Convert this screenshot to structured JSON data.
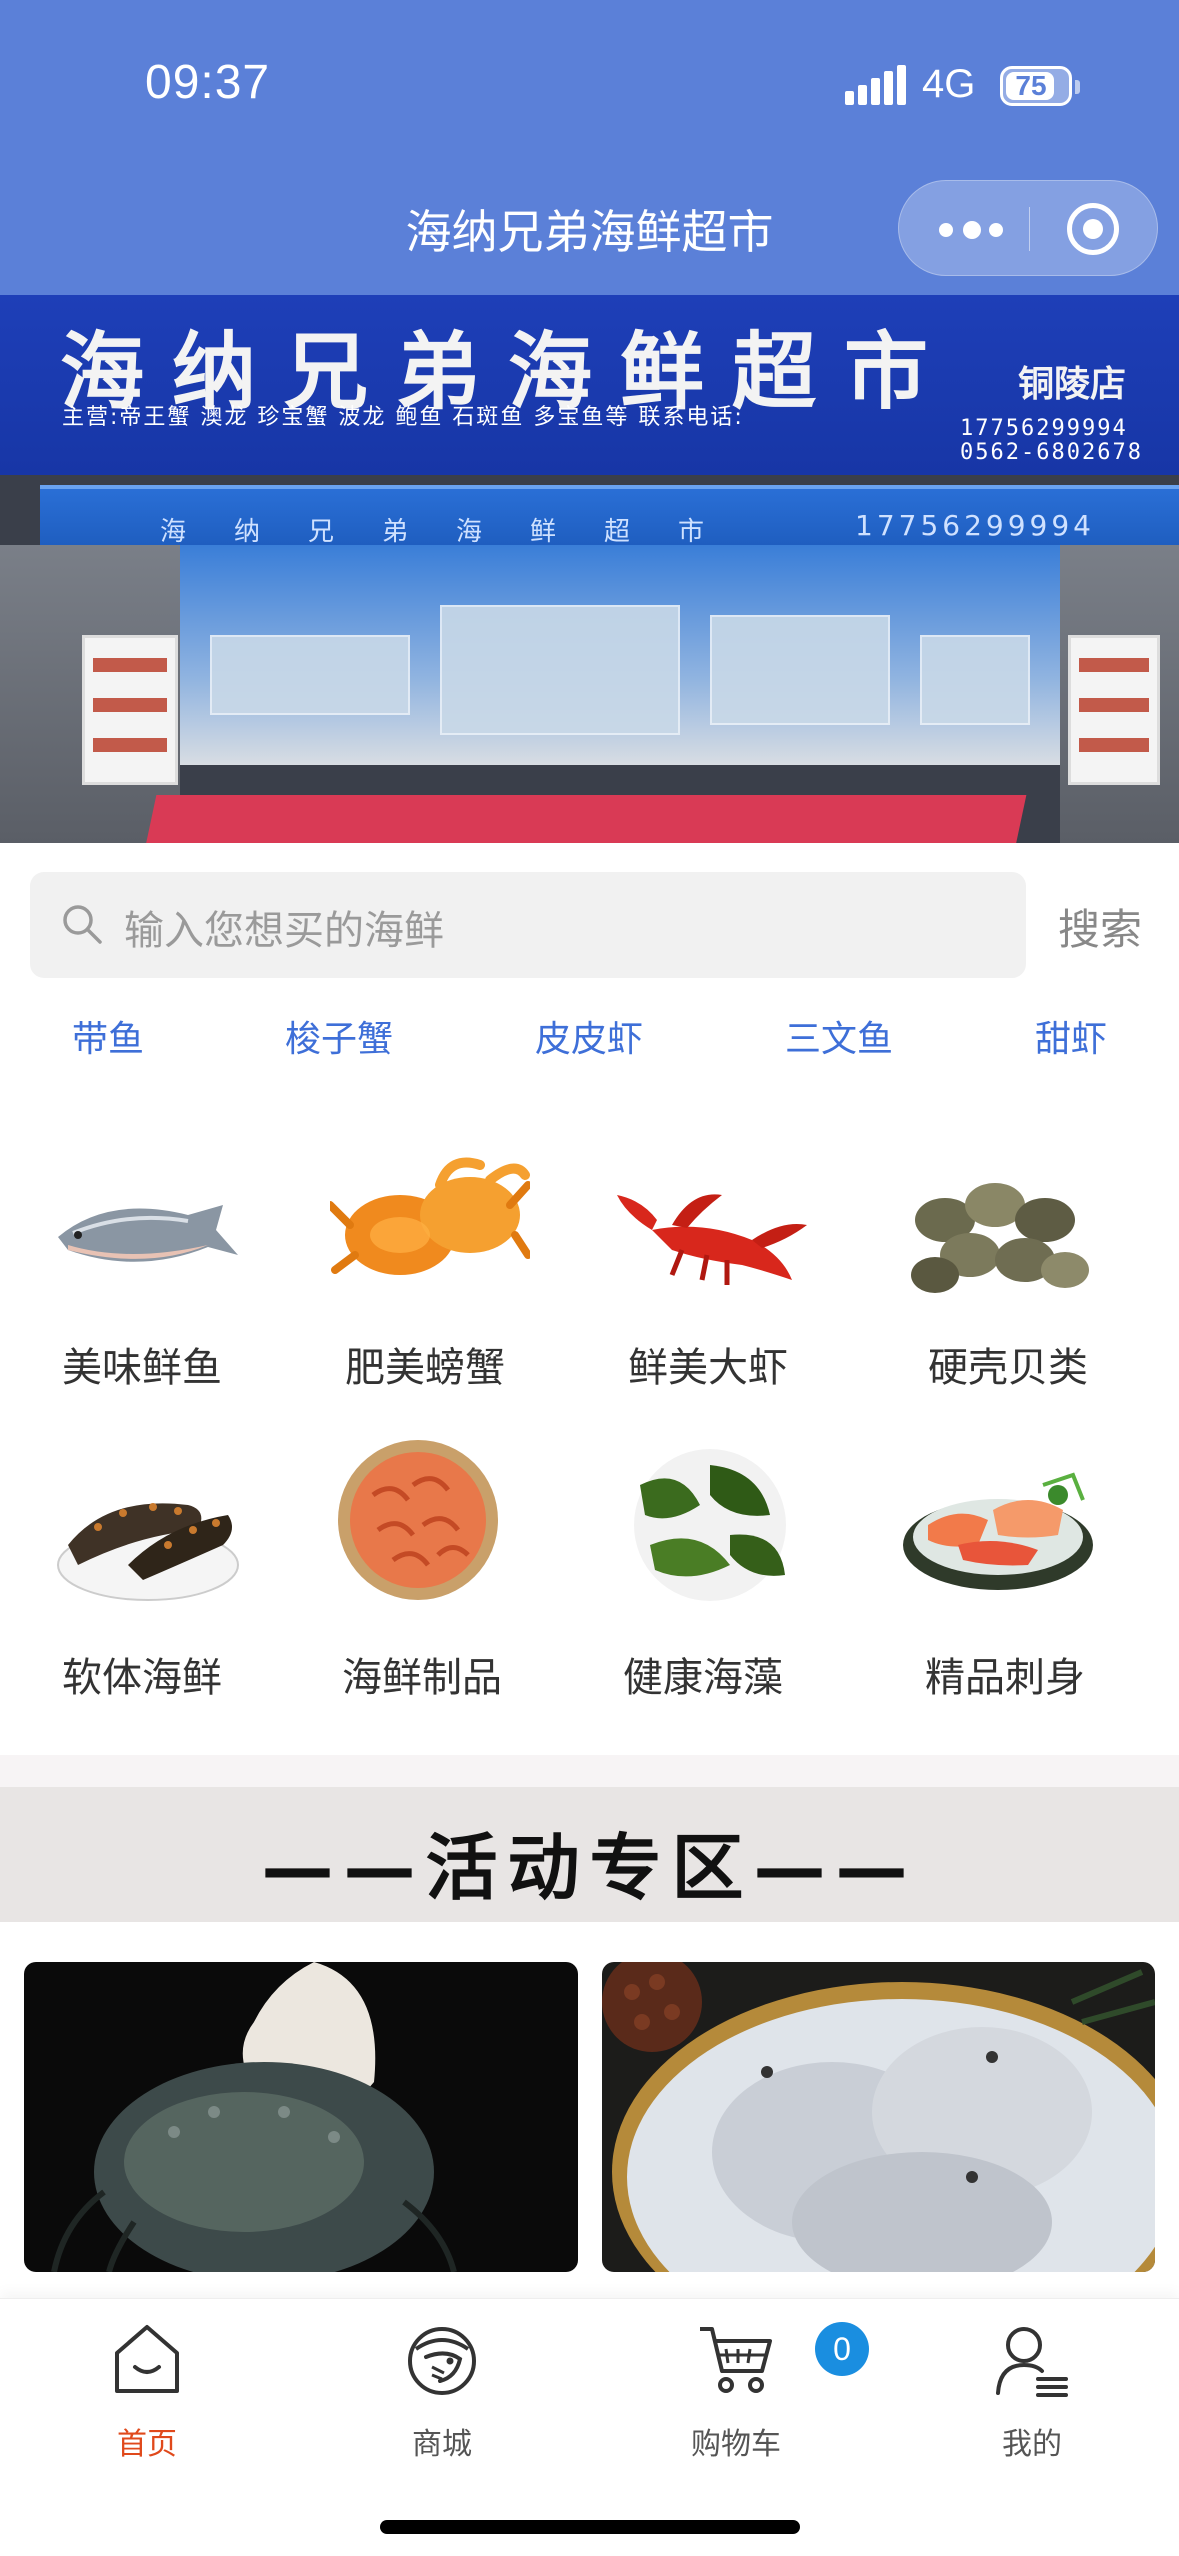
{
  "status_bar": {
    "time": "09:37",
    "network": "4G",
    "battery": "75"
  },
  "header": {
    "title": "海纳兄弟海鲜超市"
  },
  "banner": {
    "sign_title": "海纳兄弟海鲜超市",
    "sign_branch": "铜陵店",
    "sign_sub": "主营:帝王蟹 澳龙 珍宝蟹 波龙 鲍鱼 石斑鱼 多宝鱼等 联系电话:",
    "sign_phone_1": "17756299994",
    "sign_phone_2": "0562-6802678",
    "awning_text": "海纳兄弟海鲜超市",
    "awning_phone": "17756299994",
    "slides_total": 2,
    "slide_active": 1
  },
  "search": {
    "placeholder": "输入您想买的海鲜",
    "button": "搜索"
  },
  "hot_tags": [
    "带鱼",
    "梭子蟹",
    "皮皮虾",
    "三文鱼",
    "甜虾"
  ],
  "categories": [
    {
      "label": "美味鲜鱼",
      "icon": "salmon-icon"
    },
    {
      "label": "肥美螃蟹",
      "icon": "crab-icon"
    },
    {
      "label": "鲜美大虾",
      "icon": "lobster-icon"
    },
    {
      "label": "硬壳贝类",
      "icon": "clam-icon"
    },
    {
      "label": "软体海鲜",
      "icon": "sea-cucumber-icon"
    },
    {
      "label": "海鲜制品",
      "icon": "dried-shrimp-icon"
    },
    {
      "label": "健康海藻",
      "icon": "seaweed-icon"
    },
    {
      "label": "精品刺身",
      "icon": "sashimi-icon"
    }
  ],
  "activity": {
    "title": "——活动专区——"
  },
  "promos": [
    {
      "icon": "crab-promo-image"
    },
    {
      "icon": "pomfret-promo-image"
    }
  ],
  "tabbar": {
    "items": [
      {
        "label": "首页",
        "icon": "home-icon",
        "active": true
      },
      {
        "label": "商城",
        "icon": "shrimp-mall-icon",
        "active": false
      },
      {
        "label": "购物车",
        "icon": "cart-icon",
        "active": false
      },
      {
        "label": "我的",
        "icon": "user-icon",
        "active": false
      }
    ],
    "cart_count": "0"
  },
  "colors": {
    "header": "#5b80d8",
    "tag": "#3e6fd8",
    "active_tab": "#e0491b",
    "badge": "#1a8ee0"
  }
}
